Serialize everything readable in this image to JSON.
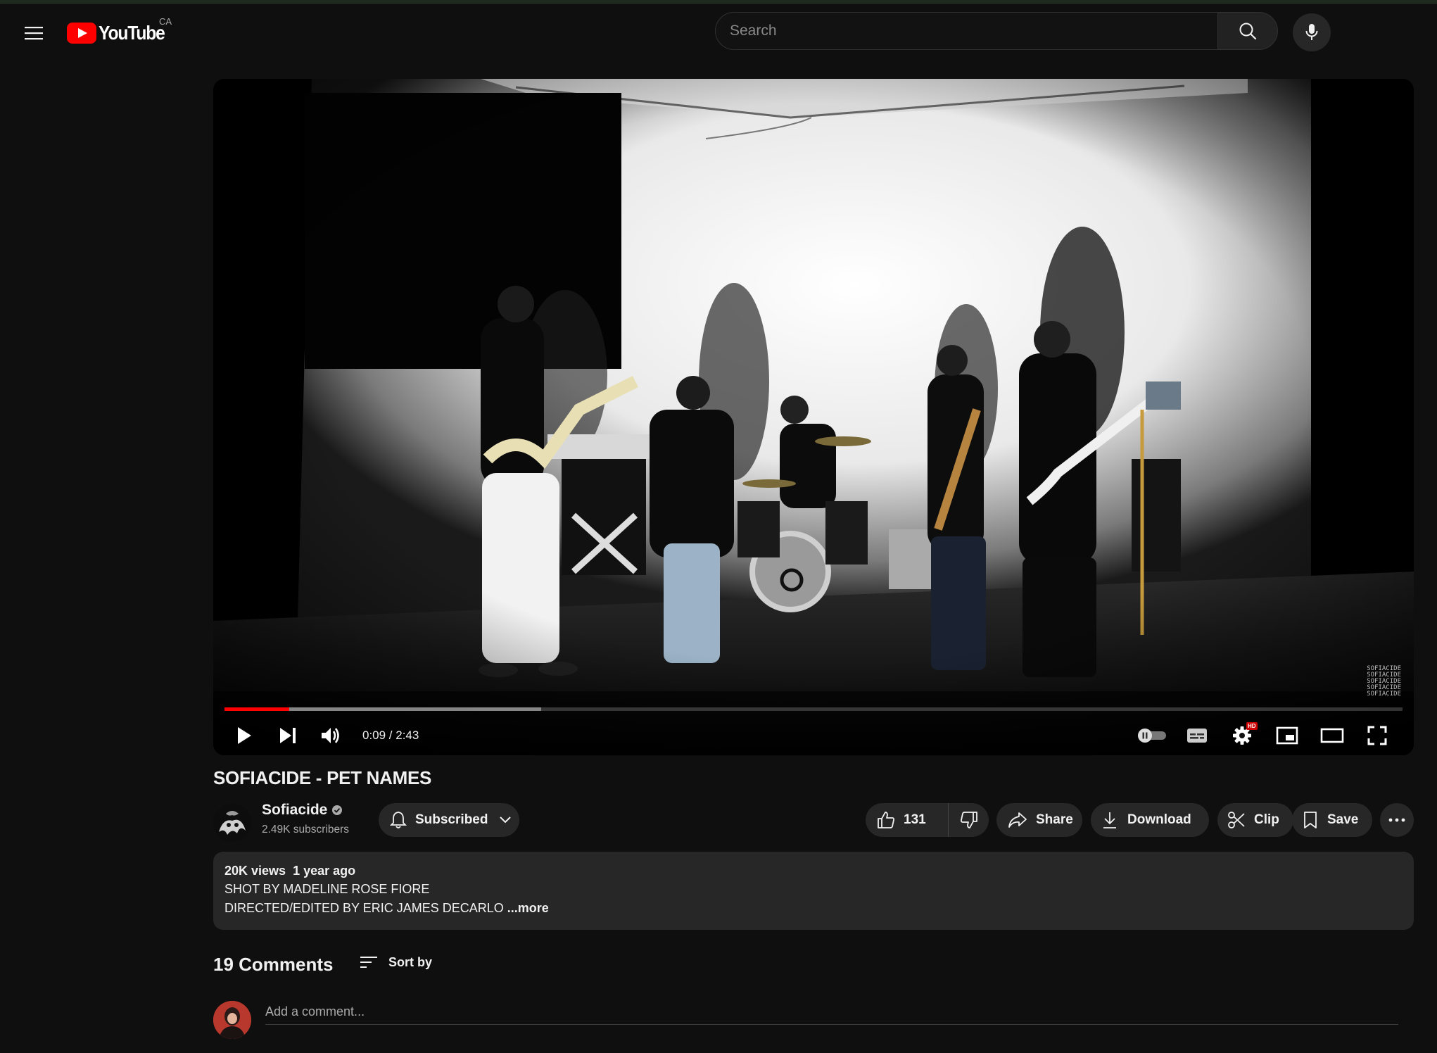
{
  "masthead": {
    "logo_text": "YouTube",
    "country_code": "CA",
    "search_placeholder": "Search"
  },
  "player": {
    "current_time": "0:09",
    "duration": "2:43",
    "time_display": "0:09 / 2:43",
    "played_fraction": 0.055,
    "buffered_fraction": 0.269,
    "watermark_text": "SOFIACIDE",
    "quality_badge": "HD"
  },
  "video": {
    "title": "SOFIACIDE - PET NAMES"
  },
  "channel": {
    "name": "Sofiacide",
    "subscribers": "2.49K subscribers",
    "verified": true
  },
  "actions": {
    "subscribe_label": "Subscribed",
    "like_count": "131",
    "share_label": "Share",
    "download_label": "Download",
    "clip_label": "Clip",
    "save_label": "Save"
  },
  "description": {
    "views": "20K views",
    "age": "1 year ago",
    "line1": "SHOT BY MADELINE ROSE FIORE",
    "line2": "DIRECTED/EDITED BY ERIC JAMES DECARLO",
    "more_label": "...more"
  },
  "comments": {
    "count_label": "19 Comments",
    "sort_label": "Sort by",
    "add_placeholder": "Add a comment..."
  },
  "colors": {
    "background": "#0f0f0f",
    "surface": "#272727",
    "brand_red": "#ff0000",
    "text": "#f1f1f1",
    "secondary_text": "#aaaaaa"
  }
}
